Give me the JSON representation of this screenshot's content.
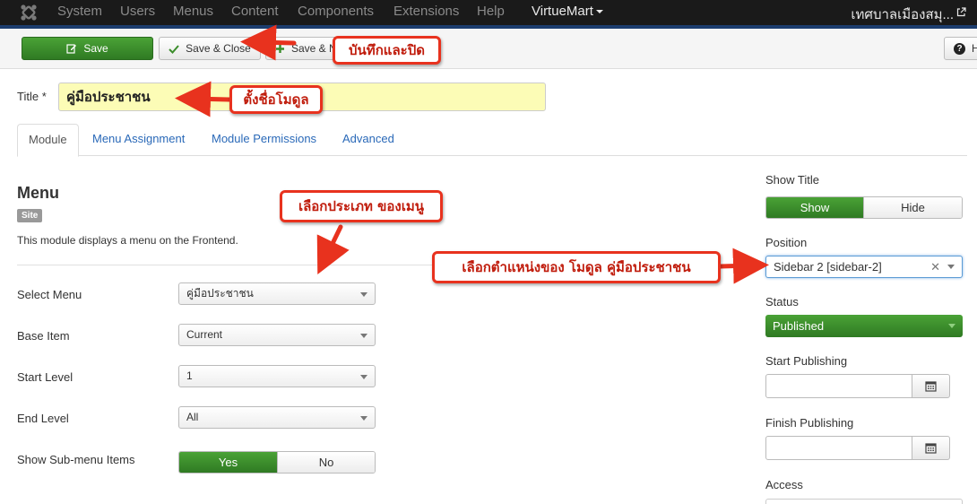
{
  "navbar": {
    "items": [
      "System",
      "Users",
      "Menus",
      "Content",
      "Components",
      "Extensions",
      "Help"
    ],
    "virtuemart": "VirtueMart",
    "site_name": "เทศบาลเมืองสมุ..."
  },
  "toolbar": {
    "save": "Save",
    "save_close": "Save & Close",
    "save_new": "Save & N",
    "help": "H"
  },
  "title": {
    "label": "Title *",
    "value": "คู่มือประชาชน"
  },
  "tabs": [
    "Module",
    "Menu Assignment",
    "Module Permissions",
    "Advanced"
  ],
  "module": {
    "heading": "Menu",
    "badge": "Site",
    "description": "This module displays a menu on the Frontend."
  },
  "fields": {
    "select_menu": {
      "label": "Select Menu",
      "value": "คู่มือประชาชน"
    },
    "base_item": {
      "label": "Base Item",
      "value": "Current"
    },
    "start_level": {
      "label": "Start Level",
      "value": "1"
    },
    "end_level": {
      "label": "End Level",
      "value": "All"
    },
    "show_submenu": {
      "label": "Show Sub-menu Items",
      "yes": "Yes",
      "no": "No",
      "selected": "Yes"
    }
  },
  "sidebar": {
    "show_title": {
      "label": "Show Title",
      "show": "Show",
      "hide": "Hide",
      "selected": "Show"
    },
    "position": {
      "label": "Position",
      "value": "Sidebar 2 [sidebar-2]"
    },
    "status": {
      "label": "Status",
      "value": "Published"
    },
    "start_publishing": {
      "label": "Start Publishing"
    },
    "finish_publishing": {
      "label": "Finish Publishing"
    },
    "access": {
      "label": "Access"
    }
  },
  "annotations": {
    "save_close": "บันทึกและปิด",
    "set_name": "ตั้งชื่อโมดูล",
    "choose_type": "เลือกประเภท ของเมนู",
    "choose_position": "เลือกตำแหน่งของ  โมดูล คู่มือประชาชน"
  },
  "colors": {
    "success_green": "#3b8d2b",
    "annotation_red": "#e8321e",
    "link_blue": "#2a69b8",
    "title_highlight": "#fcfcb6"
  }
}
